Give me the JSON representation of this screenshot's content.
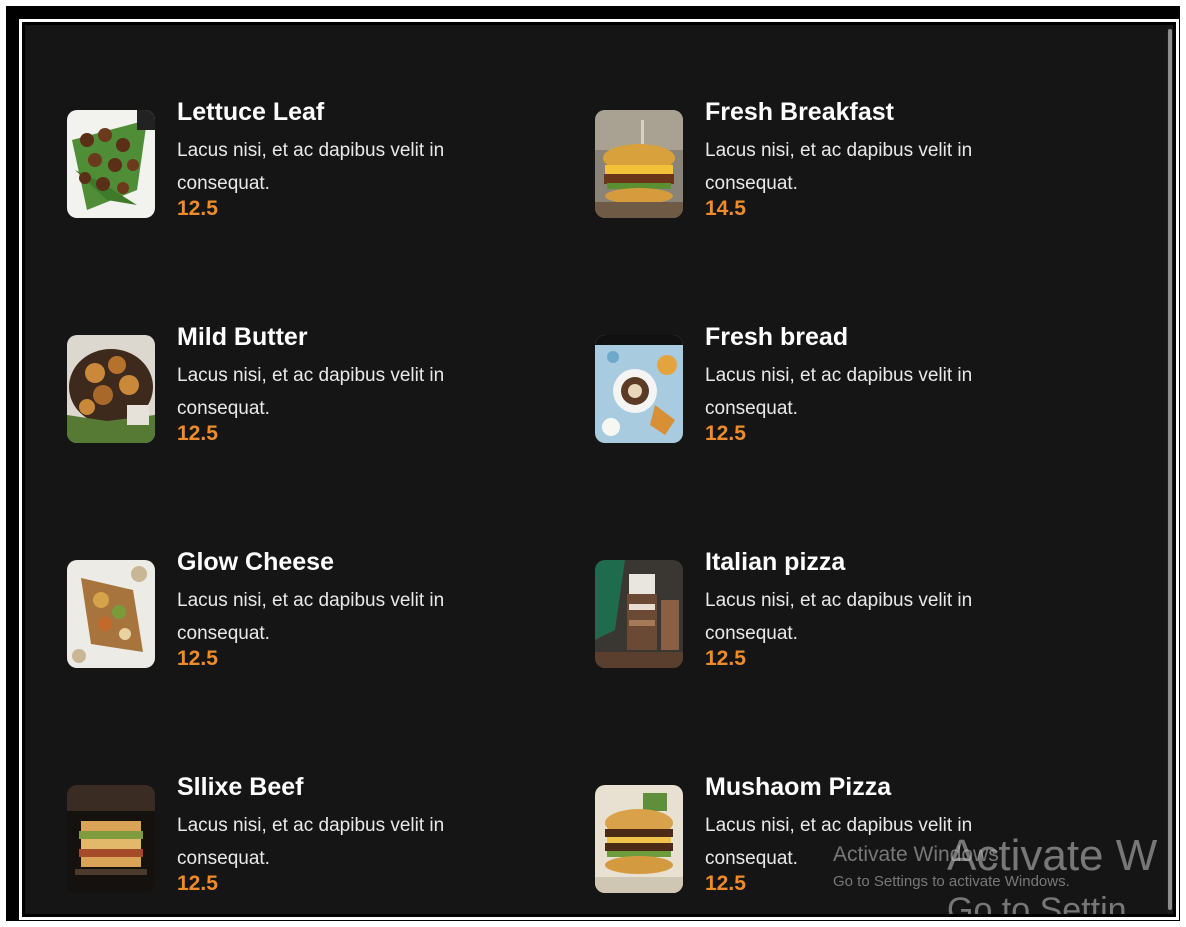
{
  "menu": {
    "items": [
      {
        "title": "Lettuce Leaf",
        "desc": "Lacus nisi, et ac dapibus velit in consequat.",
        "price": "12.5",
        "image": "meatball-salad-photo"
      },
      {
        "title": "Fresh Breakfast",
        "desc": "Lacus nisi, et ac dapibus velit in consequat.",
        "price": "14.5",
        "image": "burger-photo"
      },
      {
        "title": "Mild Butter",
        "desc": "Lacus nisi, et ac dapibus velit in consequat.",
        "price": "12.5",
        "image": "roast-potato-photo"
      },
      {
        "title": "Fresh bread",
        "desc": "Lacus nisi, et ac dapibus velit in consequat.",
        "price": "12.5",
        "image": "breakfast-table-photo"
      },
      {
        "title": "Glow Cheese",
        "desc": "Lacus nisi, et ac dapibus velit in consequat.",
        "price": "12.5",
        "image": "snack-board-photo"
      },
      {
        "title": "Italian pizza",
        "desc": "Lacus nisi, et ac dapibus velit in consequat.",
        "price": "12.5",
        "image": "milkshake-photo"
      },
      {
        "title": "Sllixe Beef",
        "desc": "Lacus nisi, et ac dapibus velit in consequat.",
        "price": "12.5",
        "image": "sandwich-photo"
      },
      {
        "title": "Mushaom Pizza",
        "desc": "Lacus nisi, et ac dapibus velit in consequat.",
        "price": "12.5",
        "image": "double-burger-photo"
      }
    ]
  },
  "watermark": {
    "title": "Activate Windows",
    "subtitle": "Go to Settings to activate Windows.",
    "big_title": "Activate W",
    "big_subtitle": "Go to Settin"
  },
  "colors": {
    "background": "#151515",
    "title": "#ffffff",
    "description": "#e9e9e9",
    "price": "#ee8b2a"
  }
}
